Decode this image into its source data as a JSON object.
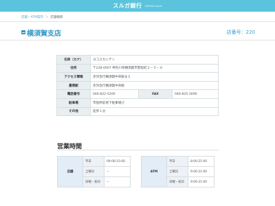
{
  "header": {
    "brand": "スルガ銀行",
    "brand_sub": "SURUGA bank"
  },
  "breadcrumb": [
    "店舗・ATM案内",
    "店舗検索"
  ],
  "branch": {
    "name": "横須賀支店",
    "number": "店番号：220"
  },
  "info_rows": [
    {
      "label": "名称（カナ）",
      "value": "ヨコスカシテン"
    },
    {
      "label": "住所",
      "value": "〒238-0007 神奈川県横須賀市若松町２－５－８"
    },
    {
      "label": "アクセス情報",
      "value": "京浜急行横須賀中央駅まえ"
    },
    {
      "label": "最寄駅",
      "value": "京浜急行横須賀中央駅"
    },
    {
      "label": "電話番号",
      "value": "046-822-5200",
      "label2": "FAX",
      "value2": "046-825-1690"
    },
    {
      "label": "駐車場",
      "value": "市役所前地下駐車場び"
    },
    {
      "label": "その他",
      "value": "徒歩１分"
    }
  ],
  "hours": {
    "title": "営業時間",
    "branch": {
      "label": "店舗",
      "rows": [
        {
          "day": "平日",
          "time": "09:00-15:00"
        },
        {
          "day": "土曜日",
          "time": "－"
        },
        {
          "day": "日曜・祝日",
          "time": "－"
        }
      ]
    },
    "atm": {
      "label": "ATM",
      "rows": [
        {
          "day": "平日",
          "time": "8:00-21:00"
        },
        {
          "day": "土曜日",
          "time": "9:00-21:00"
        },
        {
          "day": "日曜・祝日",
          "time": "9:00-21:00"
        }
      ]
    }
  },
  "colors": {
    "brand": "#5bc4dc",
    "accent": "#2f98c8",
    "th_bg": "#e9eef1"
  }
}
